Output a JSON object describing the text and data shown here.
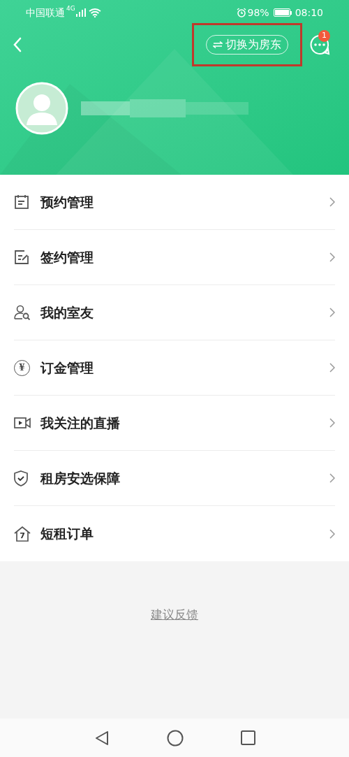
{
  "status_bar": {
    "carrier": "中国联通",
    "network": "4G",
    "battery": "98%",
    "time": "08:10"
  },
  "header": {
    "switch_button": "切换为房东",
    "message_badge": "1"
  },
  "menu_items": [
    {
      "label": "预约管理"
    },
    {
      "label": "签约管理"
    },
    {
      "label": "我的室友"
    },
    {
      "label": "订金管理",
      "icon_text": "¥"
    },
    {
      "label": "我关注的直播"
    },
    {
      "label": "租房安选保障"
    },
    {
      "label": "短租订单",
      "icon_text": "7"
    }
  ],
  "feedback_link": "建议反馈"
}
